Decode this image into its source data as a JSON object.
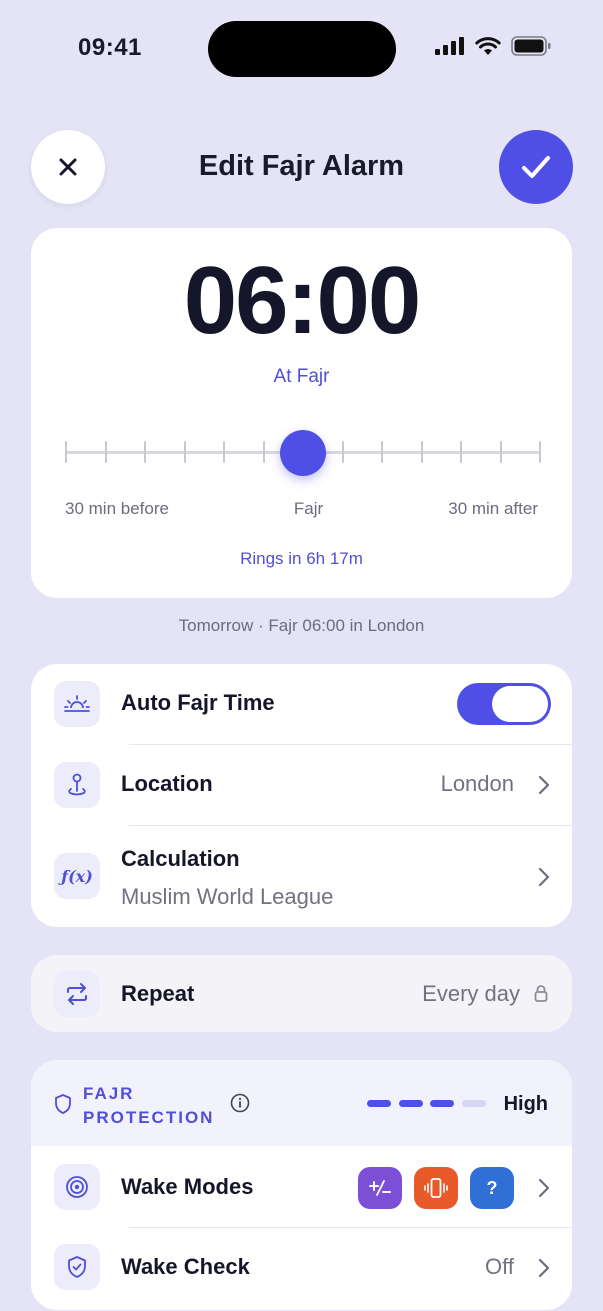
{
  "status": {
    "time": "09:41"
  },
  "header": {
    "title": "Edit Fajr Alarm"
  },
  "alarm": {
    "time": "06:00",
    "at_label": "At Fajr",
    "offset_minutes": 0,
    "slider_labels": {
      "before": "30 min before",
      "center": "Fajr",
      "after": "30 min after"
    },
    "rings_in": "Rings in 6h 17m"
  },
  "subcaption": "Tomorrow · Fajr 06:00 in London",
  "settings": {
    "auto_fajr": {
      "label": "Auto Fajr Time",
      "enabled": true
    },
    "location": {
      "label": "Location",
      "value": "London"
    },
    "calculation": {
      "label": "Calculation",
      "value": "Muslim World League"
    }
  },
  "repeat": {
    "label": "Repeat",
    "value": "Every day"
  },
  "protection": {
    "title_line1": "FAJR",
    "title_line2": "PROTECTION",
    "level": "High",
    "level_value": 3,
    "level_max": 4,
    "wake_modes": {
      "label": "Wake Modes",
      "badges": [
        {
          "icon": "math-icon",
          "glyph": "+⁄-",
          "color": "#7b4fd6"
        },
        {
          "icon": "phone-shake-icon",
          "glyph": "",
          "color": "#e85a2a"
        },
        {
          "icon": "question-icon",
          "glyph": "?",
          "color": "#2f6fd6"
        }
      ]
    },
    "wake_check": {
      "label": "Wake Check",
      "value": "Off"
    }
  },
  "colors": {
    "accent": "#4f4fe6",
    "background": "#e4e4f6"
  }
}
